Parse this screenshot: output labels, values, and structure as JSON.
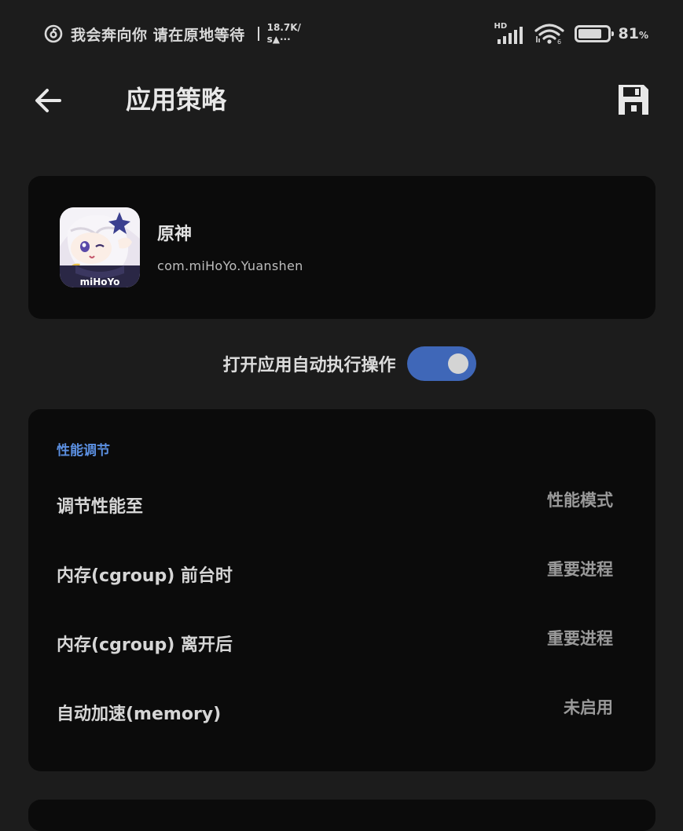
{
  "status_bar": {
    "song": "我会奔向你 请在原地等待",
    "speed_value": "18.7K/",
    "speed_unit": "s▲···",
    "network": "HD",
    "sim_slot": "6",
    "battery_level": 0.81,
    "battery_percent": "81",
    "battery_suffix": "%",
    "icons": [
      "music-app-icon",
      "signal-icon",
      "wifi-icon",
      "battery-icon"
    ]
  },
  "header": {
    "title": "应用策略",
    "back_icon": "arrow-left-icon",
    "save_icon": "floppy-disk-icon"
  },
  "app": {
    "name": "原神",
    "package": "com.miHoYo.Yuanshen",
    "icon_text": "miHoYo"
  },
  "auto_exec": {
    "label": "打开应用自动执行操作",
    "enabled": true
  },
  "performance": {
    "section_title": "性能调节",
    "rows": [
      {
        "label": "调节性能至",
        "value": "性能模式"
      },
      {
        "label": "内存(cgroup) 前台时",
        "value": "重要进程"
      },
      {
        "label": "内存(cgroup) 离开后",
        "value": "重要进程"
      },
      {
        "label": "自动加速(memory)",
        "value": "未启用"
      }
    ]
  },
  "colors": {
    "background": "#1c1c1c",
    "card": "#0b0b0b",
    "accent": "#3f67b8",
    "section_title": "#5b8fe0"
  }
}
